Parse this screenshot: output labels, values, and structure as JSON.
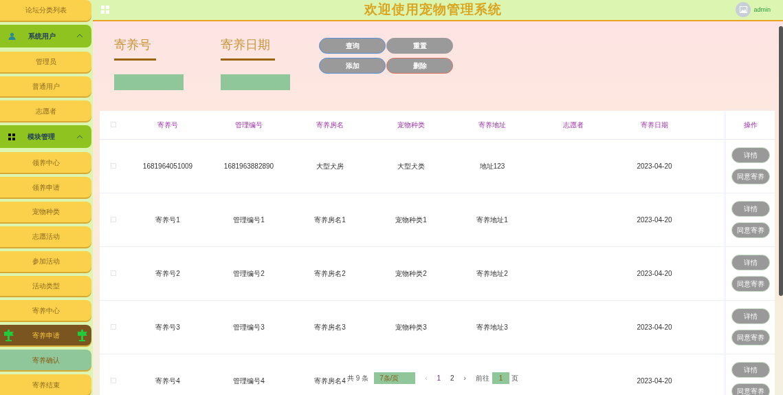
{
  "sidebar": {
    "items": [
      {
        "label": "论坛分类列表",
        "kind": "item",
        "selected": false,
        "highlighted": false
      },
      {
        "label": "系统用户",
        "kind": "usergroup",
        "expanded": true
      },
      {
        "label": "管理员",
        "kind": "item",
        "selected": false,
        "highlighted": false
      },
      {
        "label": "普通用户",
        "kind": "item",
        "selected": false,
        "highlighted": false
      },
      {
        "label": "志愿者",
        "kind": "item",
        "selected": false,
        "highlighted": false
      },
      {
        "label": "模块管理",
        "kind": "modulegroup",
        "expanded": true
      },
      {
        "label": "领养中心",
        "kind": "item",
        "selected": false,
        "highlighted": false
      },
      {
        "label": "领养申请",
        "kind": "item",
        "selected": false,
        "highlighted": false
      },
      {
        "label": "宠物种类",
        "kind": "item",
        "selected": false,
        "highlighted": false
      },
      {
        "label": "志愿活动",
        "kind": "item",
        "selected": false,
        "highlighted": false
      },
      {
        "label": "参加活动",
        "kind": "item",
        "selected": false,
        "highlighted": false
      },
      {
        "label": "活动类型",
        "kind": "item",
        "selected": false,
        "highlighted": false
      },
      {
        "label": "寄养中心",
        "kind": "item",
        "selected": false,
        "highlighted": false
      },
      {
        "label": "寄养申请",
        "kind": "item",
        "selected": true,
        "highlighted": false
      },
      {
        "label": "寄养确认",
        "kind": "item",
        "selected": false,
        "highlighted": true
      },
      {
        "label": "寄养结束",
        "kind": "item",
        "selected": false,
        "highlighted": false
      }
    ]
  },
  "header": {
    "title": "欢迎使用宠物管理系统",
    "user": "admin"
  },
  "search": {
    "fields": [
      {
        "label": "寄养号"
      },
      {
        "label": "寄养日期"
      }
    ],
    "buttons": [
      {
        "label": "查询",
        "kind": "query"
      },
      {
        "label": "重置",
        "kind": "reset"
      },
      {
        "label": "添加",
        "kind": "add"
      },
      {
        "label": "删除",
        "kind": "delete"
      }
    ]
  },
  "table": {
    "all_checked": false,
    "columns": [
      "寄养号",
      "管理编号",
      "寄养房名",
      "宠物种类",
      "寄养地址",
      "志愿者",
      "寄养日期"
    ],
    "action_column": "操作",
    "rows": [
      {
        "checked": false,
        "cells": [
          "1681964051009",
          "1681963882890",
          "大型犬房",
          "大型犬类",
          "地址123",
          "",
          "2023-04-20"
        ],
        "actions": [
          "详情",
          "同意寄养"
        ]
      },
      {
        "checked": false,
        "cells": [
          "寄养号1",
          "管理编号1",
          "寄养房名1",
          "宠物种类1",
          "寄养地址1",
          "",
          "2023-04-20"
        ],
        "actions": [
          "详情",
          "同意寄养"
        ]
      },
      {
        "checked": false,
        "cells": [
          "寄养号2",
          "管理编号2",
          "寄养房名2",
          "宠物种类2",
          "寄养地址2",
          "",
          "2023-04-20"
        ],
        "actions": [
          "详情",
          "同意寄养"
        ]
      },
      {
        "checked": false,
        "cells": [
          "寄养号3",
          "管理编号3",
          "寄养房名3",
          "宠物种类3",
          "寄养地址3",
          "",
          "2023-04-20"
        ],
        "actions": [
          "详情",
          "同意寄养"
        ]
      },
      {
        "checked": false,
        "cells": [
          "寄养号4",
          "管理编号4",
          "寄养房名4",
          "",
          "",
          "",
          "2023-04-20"
        ],
        "actions": [
          "详情",
          "同意寄养"
        ]
      }
    ]
  },
  "pagination": {
    "total": "共 9 条",
    "page_size": "7条/页",
    "prev": "‹",
    "pages": [
      {
        "label": "1",
        "selected": true
      },
      {
        "label": "2",
        "selected": false
      }
    ],
    "next": "›",
    "goto": "前往",
    "goto_value": "1",
    "goto_suffix": "页"
  }
}
